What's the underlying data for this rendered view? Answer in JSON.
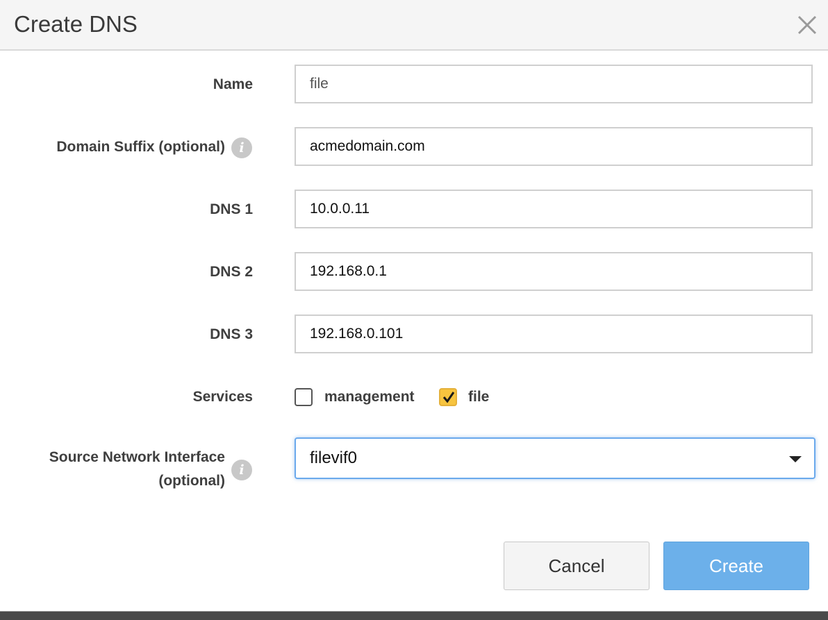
{
  "dialog": {
    "title": "Create DNS",
    "close_icon": "close-icon"
  },
  "form": {
    "name": {
      "label": "Name",
      "value": "file"
    },
    "domain_suffix": {
      "label": "Domain Suffix (optional)",
      "value": "acmedomain.com",
      "info_icon": "info-icon",
      "info_glyph": "i"
    },
    "dns1": {
      "label": "DNS 1",
      "value": "10.0.0.11"
    },
    "dns2": {
      "label": "DNS 2",
      "value": "192.168.0.1"
    },
    "dns3": {
      "label": "DNS 3",
      "value": "192.168.0.101"
    },
    "services": {
      "label": "Services",
      "options": [
        {
          "label": "management",
          "checked": false
        },
        {
          "label": "file",
          "checked": true
        }
      ]
    },
    "source_interface": {
      "label_line1": "Source Network Interface",
      "label_line2": "(optional)",
      "selected": "filevif0",
      "info_icon": "info-icon",
      "info_glyph": "i"
    }
  },
  "buttons": {
    "cancel": "Cancel",
    "create": "Create"
  },
  "colors": {
    "accent_checkbox": "#f7c43f",
    "primary_button": "#6cb0ea",
    "focus_border": "#6aa9ec"
  }
}
